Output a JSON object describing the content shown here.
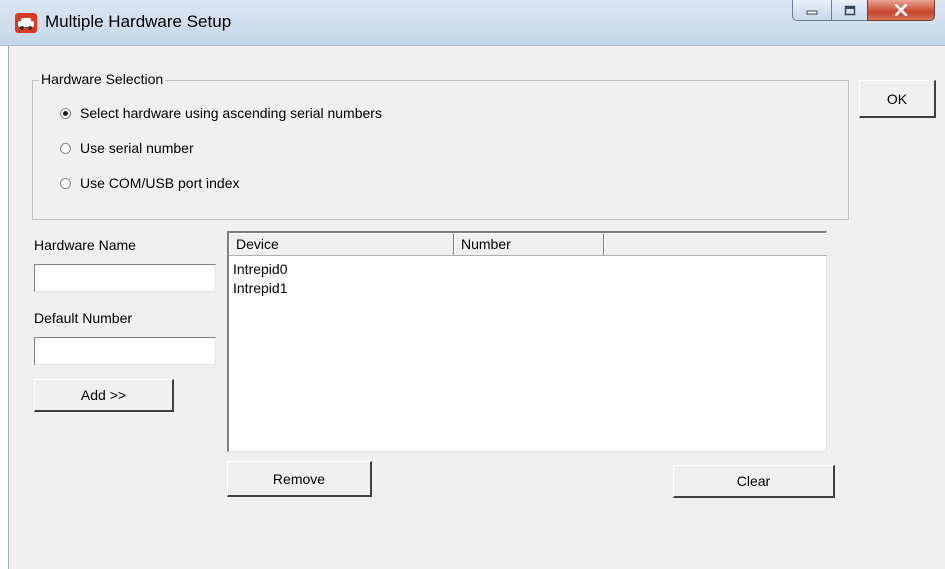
{
  "window": {
    "title": "Multiple Hardware Setup",
    "icon": "app-icon",
    "controls": [
      "minimize-icon",
      "maximize-icon",
      "close-icon"
    ]
  },
  "hardware_selection": {
    "label": "Hardware Selection",
    "options": [
      {
        "label": "Select hardware using ascending serial numbers",
        "checked": true
      },
      {
        "label": "Use serial number",
        "checked": false
      },
      {
        "label": "Use COM/USB port index",
        "checked": false
      }
    ]
  },
  "ok_label": "OK",
  "form": {
    "hardware_name_label": "Hardware Name",
    "hardware_name_value": "",
    "default_number_label": "Default Number",
    "default_number_value": "",
    "add_label": "Add >>"
  },
  "device_list": {
    "columns": [
      "Device",
      "Number",
      ""
    ],
    "rows": [
      {
        "device": "Intrepid0",
        "number": ""
      },
      {
        "device": "Intrepid1",
        "number": ""
      }
    ]
  },
  "remove_label": "Remove",
  "clear_label": "Clear",
  "colors": {
    "titlebar": "#c5d6ea",
    "client_bg": "#f0f0f0",
    "close_button": "#c6462c"
  }
}
